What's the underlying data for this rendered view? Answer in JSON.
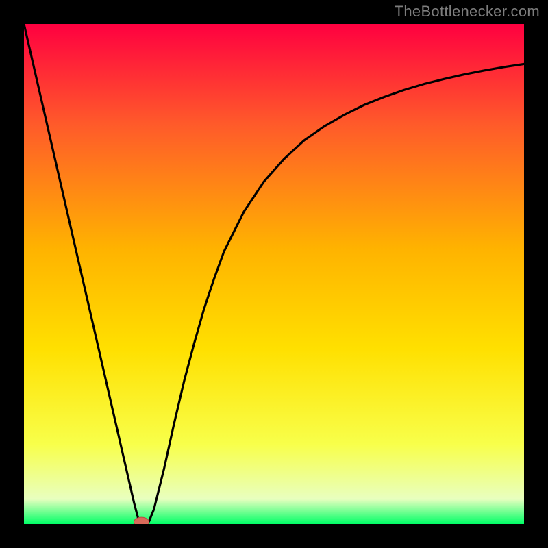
{
  "attribution": "TheBottlenecker.com",
  "colors": {
    "black": "#000000",
    "grad_top": "#ff0040",
    "grad_mid_upper": "#ff5a2a",
    "grad_mid": "#ffb300",
    "grad_mid_lower": "#ffe000",
    "grad_near_bottom": "#f8ff4a",
    "grad_bottom_pale": "#e8ffbf",
    "grad_green": "#00ff66",
    "curve": "#000000",
    "marker_fill": "#d86a5a",
    "marker_stroke": "#b84c42"
  },
  "chart_data": {
    "type": "line",
    "title": "",
    "xlabel": "",
    "ylabel": "",
    "xlim": [
      0,
      100
    ],
    "ylim": [
      0,
      100
    ],
    "x": [
      0,
      2,
      4,
      6,
      8,
      10,
      12,
      14,
      16,
      18,
      20,
      22,
      23,
      24,
      25,
      26,
      28,
      30,
      32,
      34,
      36,
      38,
      40,
      44,
      48,
      52,
      56,
      60,
      64,
      68,
      72,
      76,
      80,
      84,
      88,
      92,
      96,
      100
    ],
    "values": [
      100,
      91.3,
      82.6,
      73.9,
      65.2,
      56.5,
      47.8,
      39.1,
      30.4,
      21.7,
      13.0,
      4.3,
      0.5,
      0.0,
      0.5,
      3.0,
      11.0,
      20.0,
      28.5,
      36.0,
      43.0,
      49.0,
      54.5,
      62.5,
      68.5,
      73.0,
      76.7,
      79.5,
      81.8,
      83.8,
      85.4,
      86.8,
      88.0,
      89.0,
      89.9,
      90.7,
      91.4,
      92.0
    ],
    "marker": {
      "x": 23.5,
      "y": 0.4
    },
    "grid": false
  }
}
